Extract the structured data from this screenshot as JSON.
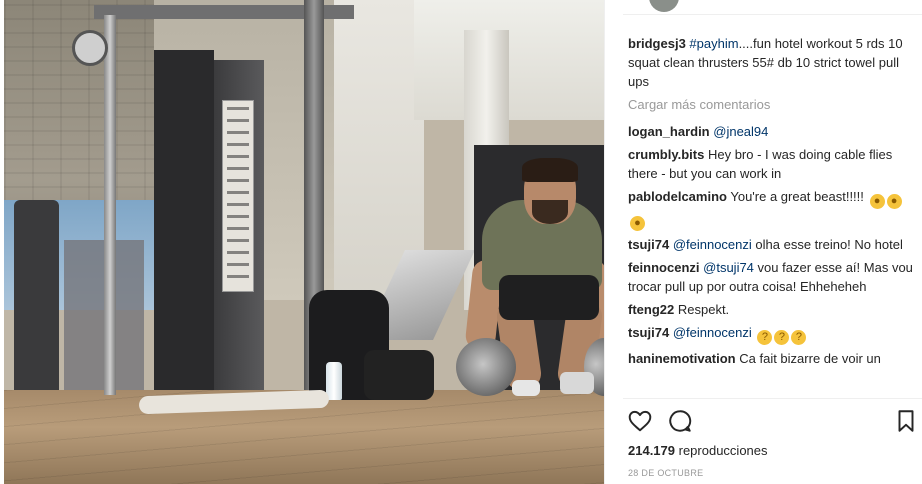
{
  "media": {
    "type": "video"
  },
  "caption": {
    "username": "bridgesj3",
    "hashtag": "#payhim",
    "text": "....fun hotel workout 5 rds 10 squat clean thrusters 55# db 10 strict towel pull ups"
  },
  "load_more": "Cargar más comentarios",
  "comments": [
    {
      "user": "logan_hardin",
      "mention": "@jneal94",
      "text": ""
    },
    {
      "user": "crumbly.bits",
      "mention": "",
      "text": "Hey bro - I was doing cable flies there - but you can work in"
    },
    {
      "user": "pablodelcamino",
      "mention": "",
      "text": "You're a great beast!!!!!",
      "emojis": [
        "flexed-biceps",
        "flexed-biceps",
        "flexed-biceps"
      ]
    },
    {
      "user": "tsuji74",
      "mention": "@feinnocenzi",
      "text": "olha esse treino! No hotel"
    },
    {
      "user": "feinnocenzi",
      "mention": "@tsuji74",
      "text": "vou fazer esse aí! Mas vou trocar pull up por outra coisa! Ehheheheh"
    },
    {
      "user": "fteng22",
      "mention": "",
      "text": "Respekt."
    },
    {
      "user": "tsuji74",
      "mention": "@feinnocenzi",
      "text": "",
      "emojis": [
        "thinking-face",
        "thinking-face",
        "thinking-face"
      ]
    },
    {
      "user": "haninemotivation",
      "mention": "",
      "text": "Ca fait bizarre de voir un"
    }
  ],
  "actions": {
    "like_icon": "heart-icon",
    "comment_icon": "comment-icon",
    "save_icon": "bookmark-icon"
  },
  "views": {
    "count": "214.179",
    "label": "reproducciones"
  },
  "date": "28 DE OCTUBRE"
}
